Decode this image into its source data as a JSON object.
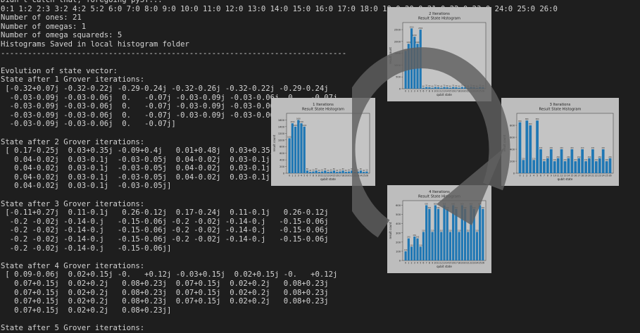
{
  "terminal": {
    "lines": [
      "Didn't catch that, foregoing pyST...",
      "0:1 1:2 2:3 3:2 4:2 5:2 6:0 7:0 8:0 9:0 10:0 11:0 12:0 13:0 14:0 15:0 16:0 17:0 18:0 19:0 20:0 21:0 22:0 23:0 24:0 25:0 26:0",
      "Number of ones: 21",
      "Number of omegas: 1",
      "Number of omega squareds: 5",
      "Histograms Saved in local histogram folder",
      "-----------------------------------------------------------------------------",
      "",
      "Evolution of state vector:",
      "State after 1 Grover iterations:",
      " [-0.32+0.07j -0.32-0.22j -0.29-0.24j -0.32-0.26j -0.32-0.22j -0.29-0.24j",
      "  -0.03-0.09j -0.03-0.06j  0.   -0.07j -0.03-0.09j -0.03-0.06j  0.   -0.07j",
      "  -0.03-0.09j -0.03-0.06j  0.   -0.07j -0.03-0.09j -0.03-0.06j  0.   -0.07j",
      "  -0.03-0.09j -0.03-0.06j  0.   -0.07j -0.03-0.09j -0.03-0.06j  0.   -0.07j",
      "  -0.03-0.09j -0.03-0.06j  0.   -0.07j]",
      "",
      "State after 2 Grover iterations:",
      " [ 0.17-0.25j  0.03+0.35j -0.09+0.4j   0.01+0.48j  0.03+0.35j -0.09+0.4j",
      "   0.04-0.02j  0.03-0.1j  -0.03-0.05j  0.04-0.02j  0.03-0.1j  -0.03-0.05j",
      "   0.04-0.02j  0.03-0.1j  -0.03-0.05j  0.04-0.02j  0.03-0.1j  -0.03-0.05j",
      "   0.04-0.02j  0.03-0.1j  -0.03-0.05j  0.04-0.02j  0.03-0.1j  -0.03-0.05j",
      "   0.04-0.02j  0.03-0.1j  -0.03-0.05j]",
      "",
      "State after 3 Grover iterations:",
      " [-0.11+0.27j  0.11-0.1j   0.26-0.12j  0.17-0.24j  0.11-0.1j   0.26-0.12j",
      "  -0.2 -0.02j -0.14-0.j   -0.15-0.06j -0.2 -0.02j -0.14-0.j   -0.15-0.06j",
      "  -0.2 -0.02j -0.14-0.j   -0.15-0.06j -0.2 -0.02j -0.14-0.j   -0.15-0.06j",
      "  -0.2 -0.02j -0.14-0.j   -0.15-0.06j -0.2 -0.02j -0.14-0.j   -0.15-0.06j",
      "  -0.2 -0.02j -0.14-0.j   -0.15-0.06j]",
      "",
      "State after 4 Grover iterations:",
      " [ 0.09-0.06j  0.02+0.15j -0.   +0.12j -0.03+0.15j  0.02+0.15j -0.   +0.12j",
      "   0.07+0.15j  0.02+0.2j   0.08+0.23j  0.07+0.15j  0.02+0.2j   0.08+0.23j",
      "   0.07+0.15j  0.02+0.2j   0.08+0.23j  0.07+0.15j  0.02+0.2j   0.08+0.23j",
      "   0.07+0.15j  0.02+0.2j   0.08+0.23j  0.07+0.15j  0.02+0.2j   0.08+0.23j",
      "   0.07+0.15j  0.02+0.2j   0.08+0.23j]",
      "",
      "State after 5 Grover iterations:"
    ]
  },
  "chart_data": [
    {
      "type": "bar",
      "title": "2 Iterations",
      "subtitle": "Result State Histogram",
      "xlabel": "qubit state",
      "ylabel": "result count",
      "categories": [
        "0",
        "1",
        "2",
        "3",
        "4",
        "5",
        "6",
        "7",
        "8",
        "9",
        "10",
        "11",
        "12",
        "13",
        "14",
        "15",
        "16",
        "17",
        "18",
        "19",
        "20",
        "21",
        "22",
        "23",
        "24",
        "25",
        "26"
      ],
      "values": [
        1600,
        1900,
        2550,
        2200,
        1900,
        2500,
        40,
        70,
        60,
        40,
        70,
        60,
        40,
        70,
        60,
        40,
        70,
        60,
        40,
        70,
        60,
        40,
        70,
        60,
        40,
        70,
        60
      ],
      "ylim": [
        0,
        2800
      ],
      "yticks": [
        0,
        500,
        1000,
        1500,
        2000,
        2500
      ]
    },
    {
      "type": "bar",
      "title": "1 Iterations",
      "subtitle": "Result State Histogram",
      "xlabel": "qubit state",
      "ylabel": "result count",
      "categories": [
        "0",
        "1",
        "2",
        "3",
        "4",
        "5",
        "6",
        "7",
        "8",
        "9",
        "10",
        "11",
        "12",
        "13",
        "14",
        "15",
        "16",
        "17",
        "18",
        "19",
        "20",
        "21",
        "22",
        "23",
        "24",
        "25",
        "26"
      ],
      "values": [
        1050,
        1500,
        1400,
        1600,
        1500,
        1400,
        80,
        40,
        50,
        80,
        40,
        50,
        80,
        40,
        50,
        80,
        40,
        50,
        80,
        40,
        50,
        80,
        40,
        50,
        80,
        40,
        50
      ],
      "ylim": [
        0,
        1800
      ],
      "yticks": [
        0,
        200,
        400,
        600,
        800,
        1000,
        1200,
        1400,
        1600
      ]
    },
    {
      "type": "bar",
      "title": "3 Iterations",
      "subtitle": "Result State Histogram",
      "xlabel": "qubit state",
      "ylabel": "result count",
      "categories": [
        "0",
        "1",
        "2",
        "3",
        "4",
        "5",
        "6",
        "7",
        "8",
        "9",
        "10",
        "11",
        "12",
        "13",
        "14",
        "15",
        "16",
        "17",
        "18",
        "19",
        "20",
        "21",
        "22",
        "23",
        "24",
        "25",
        "26"
      ],
      "values": [
        850,
        220,
        880,
        800,
        220,
        880,
        400,
        200,
        250,
        400,
        200,
        250,
        400,
        200,
        250,
        400,
        200,
        250,
        400,
        200,
        250,
        400,
        200,
        250,
        400,
        200,
        250
      ],
      "ylim": [
        0,
        1000
      ],
      "yticks": [
        0,
        200,
        400,
        600,
        800
      ]
    },
    {
      "type": "bar",
      "title": "4 Iterations",
      "subtitle": "Result State Histogram",
      "xlabel": "qubit state",
      "ylabel": "result count",
      "categories": [
        "0",
        "1",
        "2",
        "3",
        "4",
        "5",
        "6",
        "7",
        "8",
        "9",
        "10",
        "11",
        "12",
        "13",
        "14",
        "15",
        "16",
        "17",
        "18",
        "19",
        "20",
        "21",
        "22",
        "23",
        "24",
        "25",
        "26"
      ],
      "values": [
        100,
        240,
        150,
        260,
        240,
        150,
        310,
        600,
        560,
        310,
        600,
        560,
        310,
        600,
        560,
        310,
        600,
        560,
        310,
        600,
        560,
        310,
        600,
        560,
        310,
        600,
        560
      ],
      "ylim": [
        0,
        650
      ],
      "yticks": [
        0,
        100,
        200,
        300,
        400,
        500,
        600
      ]
    }
  ],
  "colors": {
    "terminal_bg": "#1e1e1e",
    "terminal_fg": "#d4d4d4",
    "bar": "#1f77b4",
    "figure_bg": "#bdbdbd",
    "arrow": "#5f5f5f"
  }
}
